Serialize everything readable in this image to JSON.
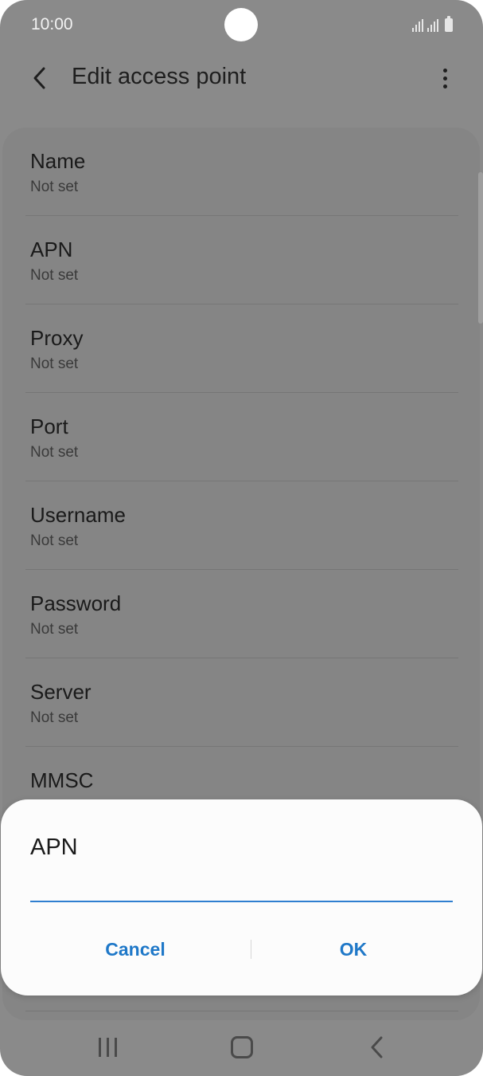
{
  "status_bar": {
    "time": "10:00"
  },
  "toolbar": {
    "back_icon": "chevron-left-icon",
    "title": "Edit access point",
    "more_icon": "more-vertical-icon"
  },
  "settings": {
    "items": [
      {
        "title": "Name",
        "value": "Not set"
      },
      {
        "title": "APN",
        "value": "Not set"
      },
      {
        "title": "Proxy",
        "value": "Not set"
      },
      {
        "title": "Port",
        "value": "Not set"
      },
      {
        "title": "Username",
        "value": "Not set"
      },
      {
        "title": "Password",
        "value": "Not set"
      },
      {
        "title": "Server",
        "value": "Not set"
      },
      {
        "title": "MMSC",
        "value": ""
      }
    ]
  },
  "dialog": {
    "title": "APN",
    "input_value": "",
    "cancel_label": "Cancel",
    "ok_label": "OK"
  },
  "colors": {
    "accent": "#1f78c8",
    "dim_background": "#8a8a8a",
    "dialog_background": "#fcfcfc"
  }
}
